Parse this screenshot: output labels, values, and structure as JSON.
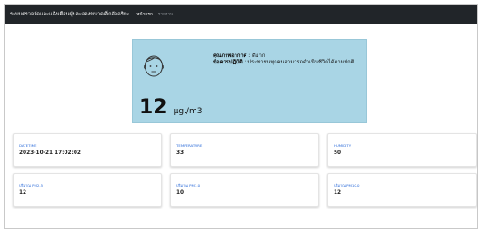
{
  "navbar": {
    "brand": "ระบบตรวจวัดและแจ้งเตือนฝุ่นละอองขนาดเล็กอัจฉริยะ",
    "links": [
      "หน้าแรก",
      "รายงาน"
    ]
  },
  "aqi_card": {
    "face_icon": "neutral-face-icon",
    "quality_label": "คุณภาพอากาศ",
    "quality_value": ": ดีมาก",
    "advice_label": "ข้อควรปฏิบัติ",
    "advice_value": ": ประชาชนทุกคนสามารถดำเนินชีวิตได้ตามปกติ",
    "value": "12",
    "unit": "µg./m3"
  },
  "cards": [
    {
      "label": "DATETIME",
      "value": "2023-10-21 17:02:02"
    },
    {
      "label": "TEMPERATURE",
      "value": "33"
    },
    {
      "label": "HUMIDITY",
      "value": "50"
    },
    {
      "label": "ปริมาณ PM2.5",
      "value": "12"
    },
    {
      "label": "ปริมาณ PM1.0",
      "value": "10"
    },
    {
      "label": "ปริมาณ PM10.0",
      "value": "12"
    }
  ],
  "colors": {
    "navbar": "#212529",
    "aqi_card": "#a9d5e5",
    "card_label": "#2b6bd9"
  }
}
